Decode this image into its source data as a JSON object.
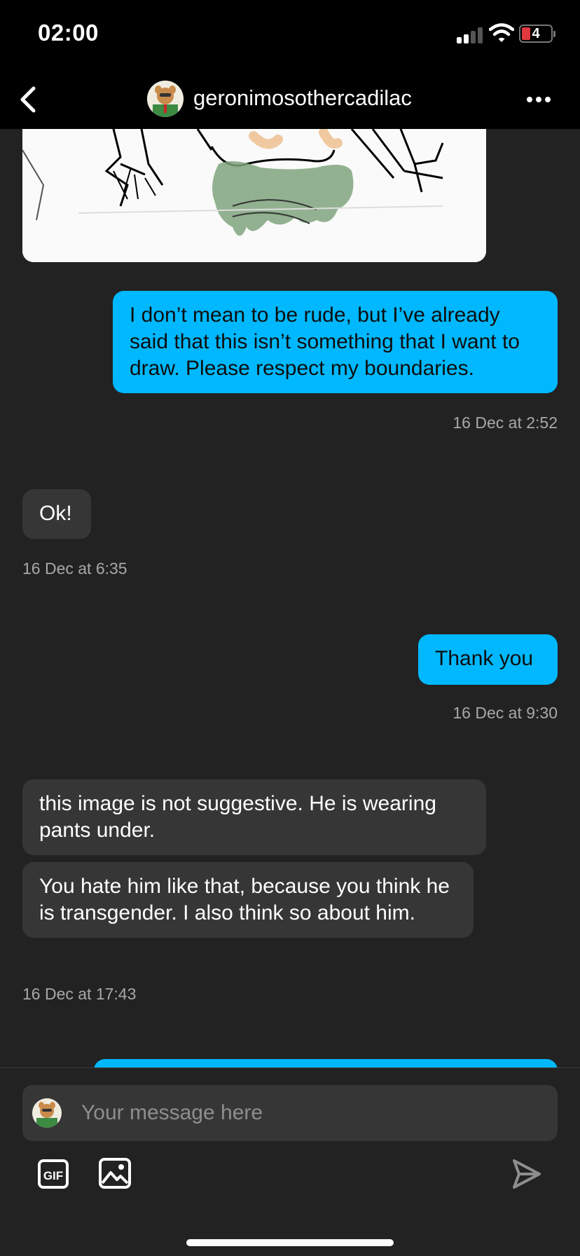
{
  "status_bar": {
    "time": "02:00",
    "battery_level": "4"
  },
  "header": {
    "username": "geronimosothercadilac"
  },
  "messages": [
    {
      "sender": "me",
      "text": "I don’t mean to be rude, but I’ve already said that this isn’t something that I want to draw. Please respect my boundaries.",
      "timestamp": "16 Dec at 2:52"
    },
    {
      "sender": "them",
      "text": "Ok!",
      "timestamp": "16 Dec at 6:35"
    },
    {
      "sender": "me",
      "text": "Thank you",
      "timestamp": "16 Dec at 9:30"
    },
    {
      "sender": "them",
      "text": "this image is not suggestive. He is wearing pants under."
    },
    {
      "sender": "them",
      "text": "You hate him like that, because you think he is transgender. I also think so about him.",
      "timestamp": "16 Dec at 17:43"
    }
  ],
  "composer": {
    "placeholder": "Your message here",
    "gif_label": "GIF"
  },
  "colors": {
    "accent": "#00b8ff",
    "background": "#222222",
    "their_bubble": "#363636",
    "header": "#000000"
  },
  "icons": [
    "back-chevron-icon",
    "more-dots-icon",
    "gif-icon",
    "image-icon",
    "send-icon",
    "wifi-icon",
    "cellular-signal-icon",
    "battery-icon"
  ]
}
